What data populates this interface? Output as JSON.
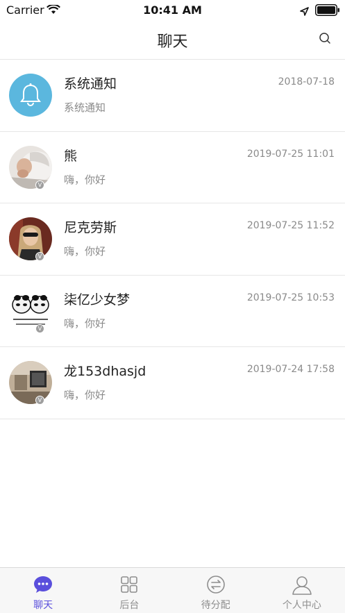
{
  "status_bar": {
    "carrier": "Carrier",
    "time": "10:41 AM"
  },
  "header": {
    "title": "聊天",
    "search_icon": "search-icon"
  },
  "chats": [
    {
      "name": "系统通知",
      "preview": "系统通知",
      "time": "2018-07-18",
      "avatar": "bell-icon",
      "color": "#5bb7de"
    },
    {
      "name": "熊",
      "preview": "嗨，你好",
      "time": "2019-07-25 11:01",
      "avatar": "photo",
      "badge": "V"
    },
    {
      "name": "尼克劳斯",
      "preview": "嗨，你好",
      "time": "2019-07-25 11:52",
      "avatar": "photo",
      "badge": "V"
    },
    {
      "name": "柒亿少女梦",
      "preview": "嗨，你好",
      "time": "2019-07-25 10:53",
      "avatar": "photo",
      "badge": "V"
    },
    {
      "name": "龙153dhasjd",
      "preview": "嗨，你好",
      "time": "2019-07-24 17:58",
      "avatar": "photo",
      "badge": "V"
    }
  ],
  "tabs": [
    {
      "label": "聊天",
      "icon": "chat-bubble-icon",
      "active": true
    },
    {
      "label": "后台",
      "icon": "grid-icon",
      "active": false
    },
    {
      "label": "待分配",
      "icon": "swap-arrows-icon",
      "active": false
    },
    {
      "label": "个人中心",
      "icon": "person-icon",
      "active": false
    }
  ],
  "colors": {
    "accent": "#5a4fdc",
    "system_avatar": "#5bb7de",
    "muted_text": "#8a8a8a"
  }
}
